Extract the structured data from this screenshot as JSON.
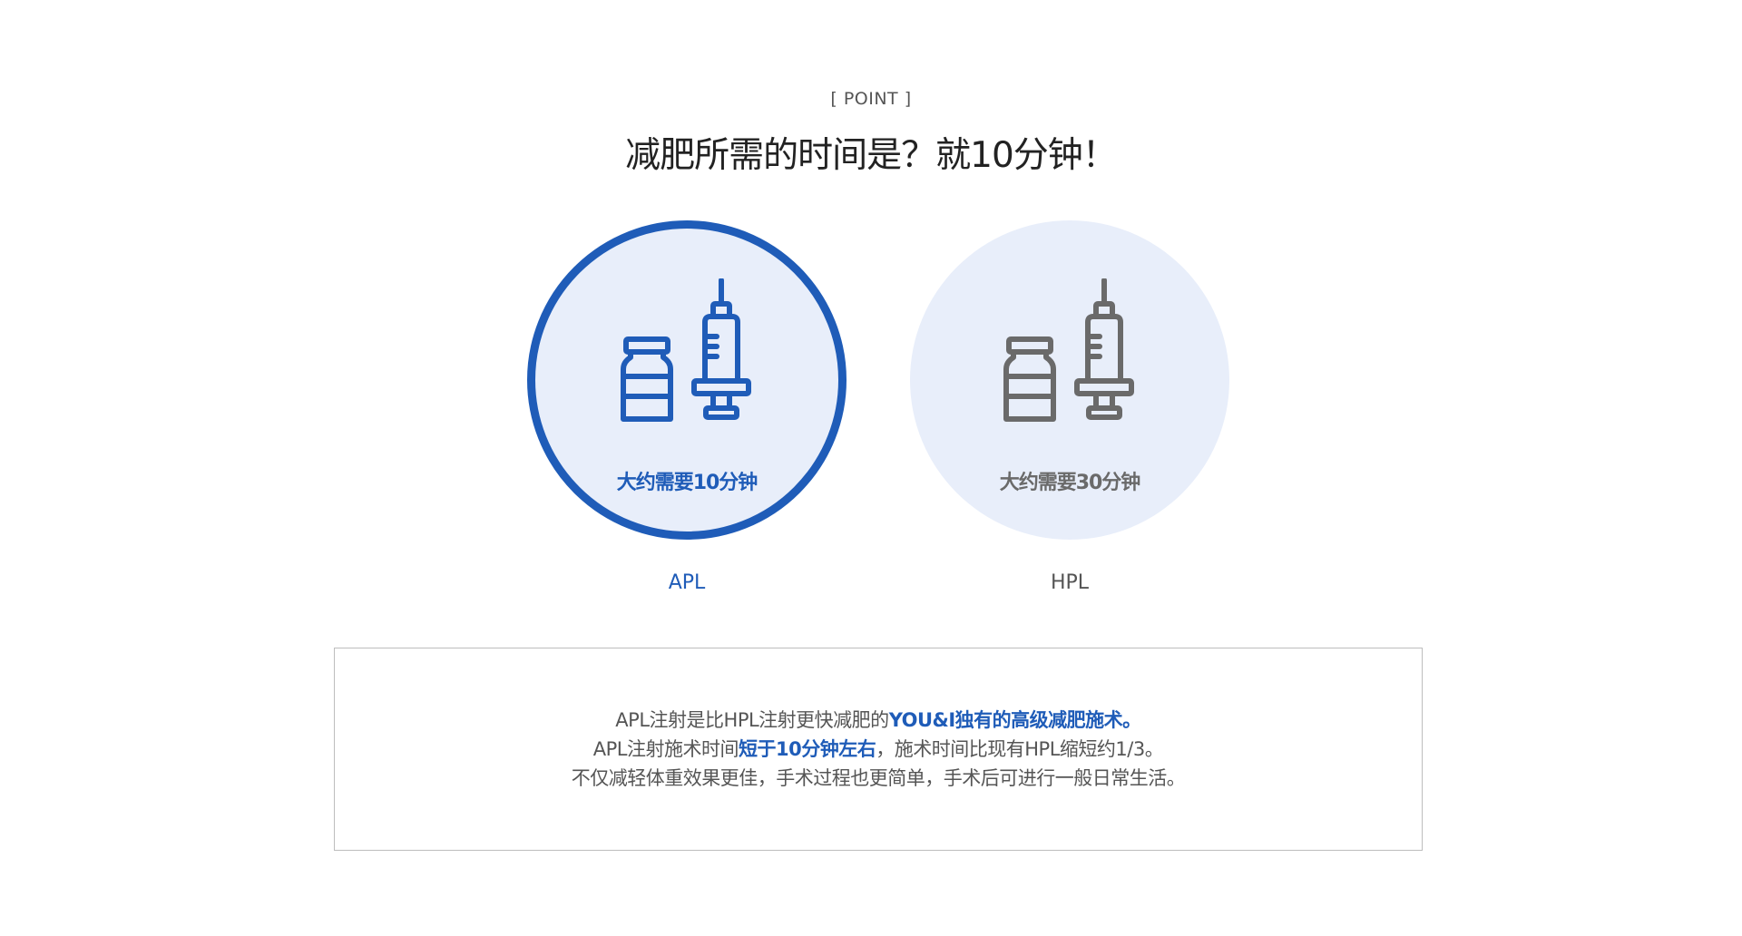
{
  "section": {
    "eyebrow": "[ POINT ]",
    "headline": "减肥所需的时间是？就10分钟！"
  },
  "cards": {
    "apl": {
      "time_text": "大约需要10分钟",
      "label": "APL",
      "color": "#1f5cb8",
      "icon": "vial-syringe-icon"
    },
    "hpl": {
      "time_text": "大约需要30分钟",
      "label": "HPL",
      "color": "#6a6a6a",
      "icon": "vial-syringe-icon"
    }
  },
  "description": {
    "line1": {
      "a": "APL注射是比HPL注射更快减肥的",
      "b": "YOU&I独有的高级减肥施术。"
    },
    "line2": {
      "a": "APL注射施术时间",
      "b": "短于10分钟左右",
      "c": "，施术时间比现有HPL缩短约1/3。"
    },
    "line3": "不仅减轻体重效果更佳，手术过程也更简单，手术后可进行一般日常生活。"
  },
  "colors": {
    "accent": "#1f5cb8",
    "circle_bg": "#e8eefa",
    "muted_icon": "#6a6a6a"
  }
}
